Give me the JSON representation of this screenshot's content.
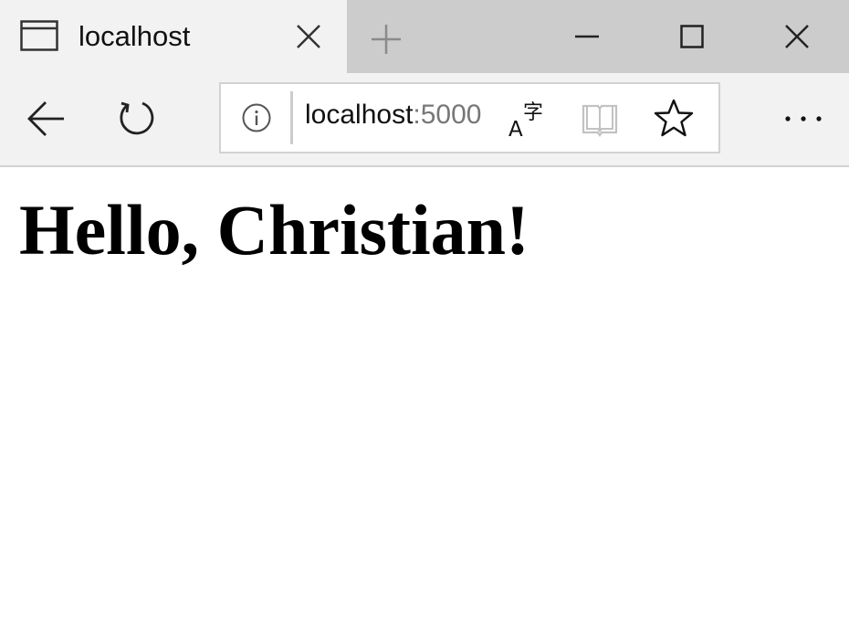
{
  "tab": {
    "title": "localhost",
    "icon": "page-icon"
  },
  "window_controls": [
    "minimize-icon",
    "maximize-icon",
    "close-icon"
  ],
  "navigation": {
    "back_icon": "back-arrow-icon",
    "refresh_icon": "refresh-icon"
  },
  "address_bar": {
    "host": "localhost",
    "port": ":5000",
    "info_icon": "info-icon",
    "translate_icon": "translate-icon",
    "reading_view_icon": "reading-view-icon",
    "favorite_icon": "star-icon"
  },
  "more_icon": "more-icon",
  "page": {
    "heading": "Hello, Christian!"
  },
  "colors": {
    "titlebar": "#cccccc",
    "active_tab": "#f2f2f2",
    "toolbar": "#f2f2f2",
    "address_bg": "#ffffff",
    "port_text": "#777777",
    "reading_icon_disabled": "#c2c2c2"
  }
}
